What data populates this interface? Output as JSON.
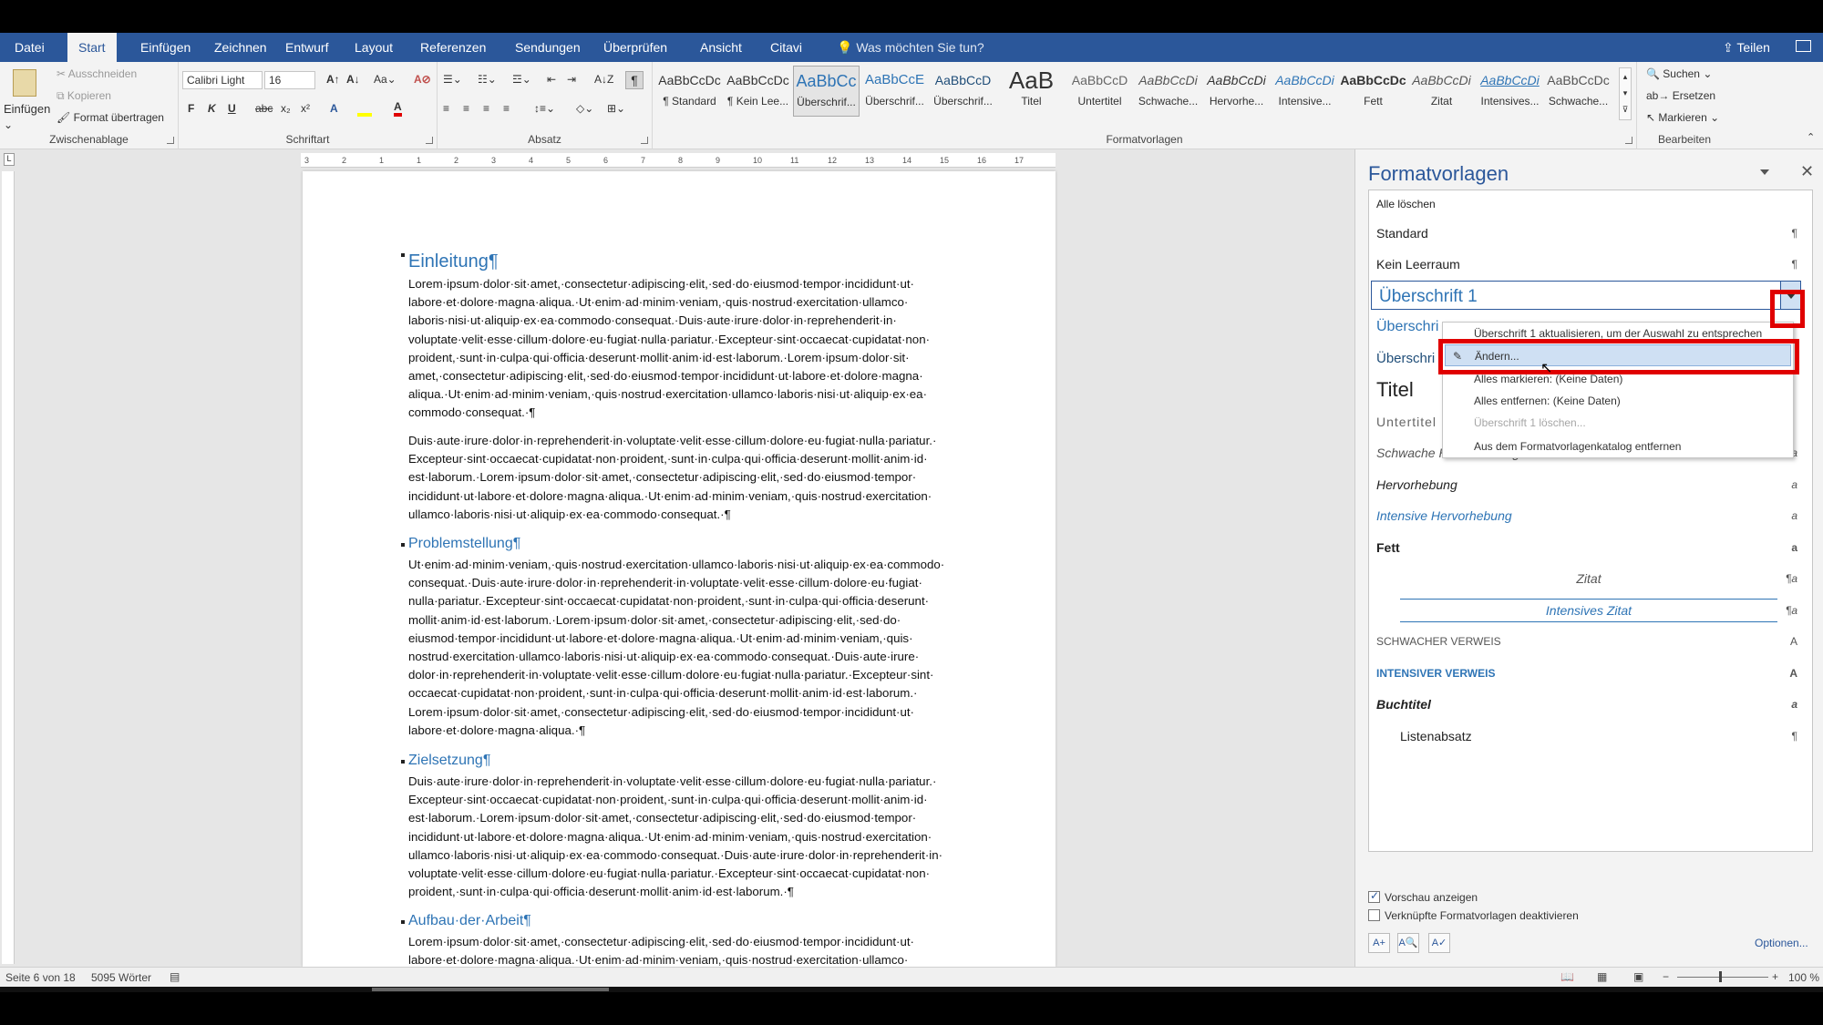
{
  "menu": {
    "tabs": [
      "Datei",
      "Start",
      "Einfügen",
      "Zeichnen",
      "Entwurf",
      "Layout",
      "Referenzen",
      "Sendungen",
      "Überprüfen",
      "Ansicht",
      "Citavi"
    ],
    "active_tab": "Start",
    "tell_me": "Was möchten Sie tun?",
    "share": "Teilen"
  },
  "ribbon": {
    "clipboard": {
      "paste": "Einfügen",
      "cut": "Ausschneiden",
      "copy": "Kopieren",
      "format_painter": "Format übertragen",
      "label": "Zwischenablage"
    },
    "font": {
      "name": "Calibri Light",
      "size": "16",
      "label": "Schriftart"
    },
    "paragraph": {
      "label": "Absatz"
    },
    "styles": {
      "label": "Formatvorlagen",
      "tiles": [
        {
          "preview": "AaBbCcDc",
          "name": "¶ Standard"
        },
        {
          "preview": "AaBbCcDc",
          "name": "¶ Kein Lee..."
        },
        {
          "preview": "AaBbCc",
          "name": "Überschrif..."
        },
        {
          "preview": "AaBbCcE",
          "name": "Überschrif..."
        },
        {
          "preview": "AaBbCcD",
          "name": "Überschrif..."
        },
        {
          "preview": "AaB",
          "name": "Titel"
        },
        {
          "preview": "AaBbCcD",
          "name": "Untertitel"
        },
        {
          "preview": "AaBbCcDi",
          "name": "Schwache..."
        },
        {
          "preview": "AaBbCcDi",
          "name": "Hervorhe..."
        },
        {
          "preview": "AaBbCcDi",
          "name": "Intensive..."
        },
        {
          "preview": "AaBbCcDc",
          "name": "Fett"
        },
        {
          "preview": "AaBbCcDi",
          "name": "Zitat"
        },
        {
          "preview": "AaBbCcDi",
          "name": "Intensives..."
        },
        {
          "preview": "AaBbCcDc",
          "name": "Schwache..."
        }
      ]
    },
    "editing": {
      "find": "Suchen",
      "replace": "Ersetzen",
      "select": "Markieren",
      "label": "Bearbeiten"
    }
  },
  "ruler": {
    "marks": [
      "3",
      "2",
      "1",
      "1",
      "2",
      "3",
      "4",
      "5",
      "6",
      "7",
      "8",
      "9",
      "10",
      "11",
      "12",
      "13",
      "14",
      "15",
      "16",
      "17"
    ]
  },
  "document": {
    "h_einleitung": "Einleitung¶",
    "p1": "Lorem·ipsum·dolor·sit·amet,·consectetur·adipiscing·elit,·sed·do·eiusmod·tempor·incididunt·ut·\nlabore·et·dolore·magna·aliqua.·Ut·enim·ad·minim·veniam,·quis·nostrud·exercitation·ullamco·\nlaboris·nisi·ut·aliquip·ex·ea·commodo·consequat.·Duis·aute·irure·dolor·in·reprehenderit·in·\nvoluptate·velit·esse·cillum·dolore·eu·fugiat·nulla·pariatur.·Excepteur·sint·occaecat·cupidatat·non·\nproident,·sunt·in·culpa·qui·officia·deserunt·mollit·anim·id·est·laborum.·Lorem·ipsum·dolor·sit·\namet,·consectetur·adipiscing·elit,·sed·do·eiusmod·tempor·incididunt·ut·labore·et·dolore·magna·\naliqua.·Ut·enim·ad·minim·veniam,·quis·nostrud·exercitation·ullamco·laboris·nisi·ut·aliquip·ex·ea·\ncommodo·consequat.·¶",
    "p2": "Duis·aute·irure·dolor·in·reprehenderit·in·voluptate·velit·esse·cillum·dolore·eu·fugiat·nulla·pariatur.·\nExcepteur·sint·occaecat·cupidatat·non·proident,·sunt·in·culpa·qui·officia·deserunt·mollit·anim·id·\nest·laborum.·Lorem·ipsum·dolor·sit·amet,·consectetur·adipiscing·elit,·sed·do·eiusmod·tempor·\nincididunt·ut·labore·et·dolore·magna·aliqua.·Ut·enim·ad·minim·veniam,·quis·nostrud·exercitation·\nullamco·laboris·nisi·ut·aliquip·ex·ea·commodo·consequat.·¶",
    "h_problem": "Problemstellung¶",
    "p3": "Ut·enim·ad·minim·veniam,·quis·nostrud·exercitation·ullamco·laboris·nisi·ut·aliquip·ex·ea·commodo·\nconsequat.·Duis·aute·irure·dolor·in·reprehenderit·in·voluptate·velit·esse·cillum·dolore·eu·fugiat·\nnulla·pariatur.·Excepteur·sint·occaecat·cupidatat·non·proident,·sunt·in·culpa·qui·officia·deserunt·\nmollit·anim·id·est·laborum.·Lorem·ipsum·dolor·sit·amet,·consectetur·adipiscing·elit,·sed·do·\neiusmod·tempor·incididunt·ut·labore·et·dolore·magna·aliqua.·Ut·enim·ad·minim·veniam,·quis·\nnostrud·exercitation·ullamco·laboris·nisi·ut·aliquip·ex·ea·commodo·consequat.·Duis·aute·irure·\ndolor·in·reprehenderit·in·voluptate·velit·esse·cillum·dolore·eu·fugiat·nulla·pariatur.·Excepteur·sint·\noccaecat·cupidatat·non·proident,·sunt·in·culpa·qui·officia·deserunt·mollit·anim·id·est·laborum.·\nLorem·ipsum·dolor·sit·amet,·consectetur·adipiscing·elit,·sed·do·eiusmod·tempor·incididunt·ut·\nlabore·et·dolore·magna·aliqua.·¶",
    "h_ziel": "Zielsetzung¶",
    "p4": "Duis·aute·irure·dolor·in·reprehenderit·in·voluptate·velit·esse·cillum·dolore·eu·fugiat·nulla·pariatur.·\nExcepteur·sint·occaecat·cupidatat·non·proident,·sunt·in·culpa·qui·officia·deserunt·mollit·anim·id·\nest·laborum.·Lorem·ipsum·dolor·sit·amet,·consectetur·adipiscing·elit,·sed·do·eiusmod·tempor·\nincididunt·ut·labore·et·dolore·magna·aliqua.·Ut·enim·ad·minim·veniam,·quis·nostrud·exercitation·\nullamco·laboris·nisi·ut·aliquip·ex·ea·commodo·consequat.·Duis·aute·irure·dolor·in·reprehenderit·in·\nvoluptate·velit·esse·cillum·dolore·eu·fugiat·nulla·pariatur.·Excepteur·sint·occaecat·cupidatat·non·\nproident,·sunt·in·culpa·qui·officia·deserunt·mollit·anim·id·est·laborum.·¶",
    "h_aufbau": "Aufbau·der·Arbeit¶",
    "p5": "Lorem·ipsum·dolor·sit·amet,·consectetur·adipiscing·elit,·sed·do·eiusmod·tempor·incididunt·ut·\nlabore·et·dolore·magna·aliqua.·Ut·enim·ad·minim·veniam,·quis·nostrud·exercitation·ullamco·"
  },
  "pane": {
    "title": "Formatvorlagen",
    "clear_all": "Alle löschen",
    "styles": [
      {
        "name": "Standard",
        "mark": "¶"
      },
      {
        "name": "Kein Leerraum",
        "mark": "¶"
      },
      {
        "name": "Überschrift 1",
        "mark": ""
      },
      {
        "name": "Überschri",
        "mark": ""
      },
      {
        "name": "Überschri",
        "mark": ""
      },
      {
        "name": "Titel",
        "mark": ""
      },
      {
        "name": "Untertitel",
        "mark": ""
      },
      {
        "name": "Schwache Hervorhebung",
        "mark": "a"
      },
      {
        "name": "Hervorhebung",
        "mark": "a"
      },
      {
        "name": "Intensive Hervorhebung",
        "mark": "a"
      },
      {
        "name": "Fett",
        "mark": "a"
      },
      {
        "name": "Zitat",
        "mark": "¶a"
      },
      {
        "name": "Intensives Zitat",
        "mark": "¶a"
      },
      {
        "name": "Schwacher Verweis",
        "mark": "a"
      },
      {
        "name": "Intensiver Verweis",
        "mark": "a"
      },
      {
        "name": "Buchtitel",
        "mark": "a"
      },
      {
        "name": "Listenabsatz",
        "mark": "¶"
      }
    ],
    "context_menu": [
      "Überschrift 1 aktualisieren, um der Auswahl zu entsprechen",
      "Ändern...",
      "Alles markieren: (Keine Daten)",
      "Alles entfernen: (Keine Daten)",
      "Überschrift 1 löschen...",
      "Aus dem Formatvorlagenkatalog entfernen"
    ],
    "show_preview": "Vorschau anzeigen",
    "disable_linked": "Verknüpfte Formatvorlagen deaktivieren",
    "options": "Optionen..."
  },
  "status": {
    "page": "Seite 6 von 18",
    "words": "5095 Wörter",
    "zoom": "100 %"
  },
  "colors": {
    "accent": "#2b579a",
    "heading": "#2e74b5",
    "highlight_box": "#e00000"
  }
}
